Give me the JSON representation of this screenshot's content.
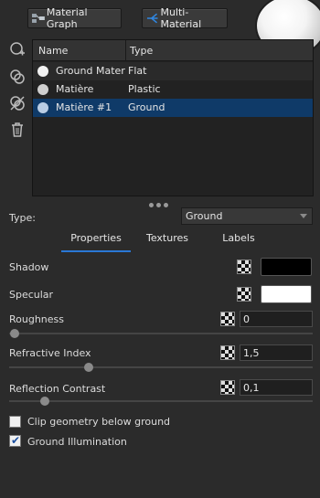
{
  "toolbar": {
    "material_graph_label": "Material Graph",
    "multi_material_label": "Multi-Material"
  },
  "list": {
    "col_name": "Name",
    "col_type": "Type",
    "rows": [
      {
        "name": "Ground Materi",
        "type": "Flat",
        "color": "#f2f2f2",
        "selected": false
      },
      {
        "name": "Matière",
        "type": "Plastic",
        "color": "#cfcfcf",
        "selected": false
      },
      {
        "name": "Matière #1",
        "type": "Ground",
        "color": "#b9cde4",
        "selected": true
      }
    ]
  },
  "type_field": {
    "label": "Type:",
    "value": "Ground"
  },
  "tabs": [
    "Properties",
    "Textures",
    "Labels"
  ],
  "props": {
    "shadow_label": "Shadow",
    "shadow_color": "#000000",
    "specular_label": "Specular",
    "specular_color": "#ffffff",
    "roughness_label": "Roughness",
    "roughness_value": "0",
    "refractive_label": "Refractive Index",
    "refractive_value": "1,5",
    "reflection_label": "Reflection Contrast",
    "reflection_value": "0,1"
  },
  "checkboxes": {
    "clip_label": "Clip geometry below ground",
    "clip_checked": false,
    "illum_label": "Ground Illumination",
    "illum_checked": true
  },
  "colors": {
    "accent": "#2a78d6",
    "selection": "#0f3a68"
  }
}
